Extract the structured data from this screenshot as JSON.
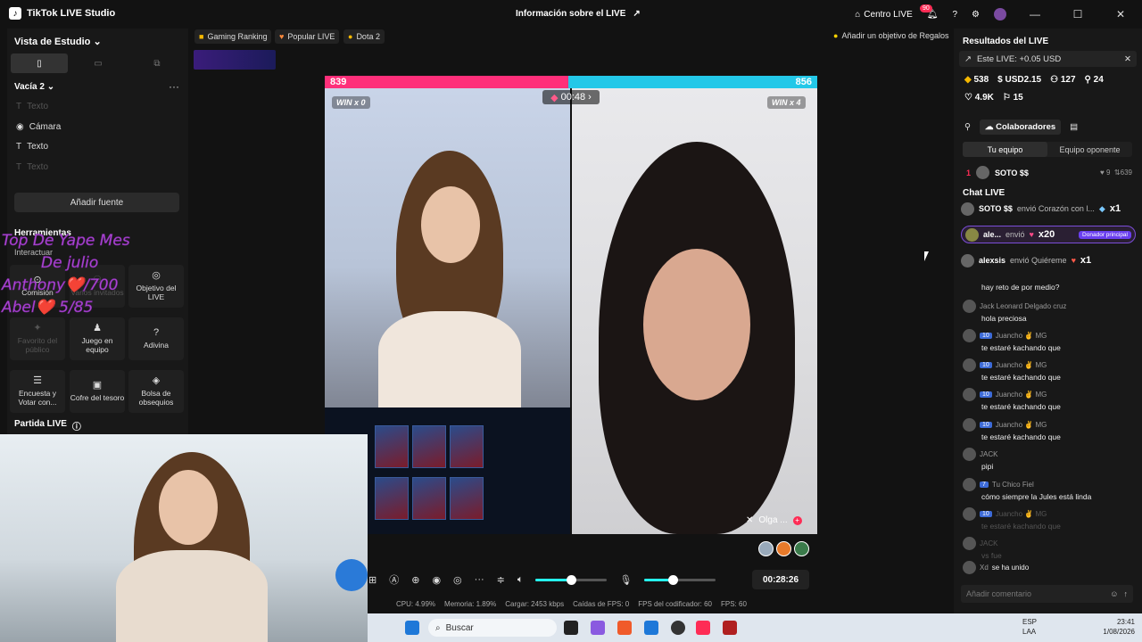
{
  "titlebar": {
    "app_name": "TikTok LIVE Studio",
    "center_title": "Información sobre el LIVE",
    "centro_live": "Centro LIVE",
    "notif_count": "90"
  },
  "left_panel": {
    "title": "Vista de Estudio",
    "scene_name": "Vacía 2",
    "sources": [
      "Texto",
      "Cámara",
      "Texto",
      "Texto"
    ],
    "add_source": "Añadir fuente",
    "tools_header": "Herramientas",
    "interact_label": "Interactuar",
    "tools": [
      {
        "label": "Comisión",
        "icon": "commission-icon"
      },
      {
        "label": "Varios invitados",
        "icon": "guests-icon"
      },
      {
        "label": "Objetivo del LIVE",
        "icon": "target-icon"
      },
      {
        "label": "Favorito del público",
        "icon": "star-icon"
      },
      {
        "label": "Juego en equipo",
        "icon": "team-icon"
      },
      {
        "label": "Adivina",
        "icon": "question-icon"
      },
      {
        "label": "Encuesta y Votar con...",
        "icon": "poll-icon"
      },
      {
        "label": "Cofre del tesoro",
        "icon": "chest-icon"
      },
      {
        "label": "Bolsa de obsequios",
        "icon": "bag-icon"
      }
    ],
    "partida": "Partida LIVE"
  },
  "overlay_text": {
    "line1": "Top De Yape  Mes",
    "line2": "De julio",
    "line3": "Anthony❤️/700",
    "line4": "Abel❤️      5/85"
  },
  "topbar": {
    "pills": [
      "Gaming Ranking",
      "Popular LIVE",
      "Dota 2"
    ],
    "goal": "Añadir un objetivo de Regalos"
  },
  "battle": {
    "left_score": "839",
    "right_score": "856",
    "left_win": "WIN x 0",
    "right_win": "WIN x 4",
    "timer": "00:48",
    "guest_name": "Olga ..."
  },
  "controls": {
    "elapsed": "00:28:26",
    "volume": 0.5,
    "mic": 0.4
  },
  "stats": {
    "cpu": "CPU: 4.99%",
    "mem": "Memoria: 1.89%",
    "load": "Cargar: 2453 kbps",
    "fps_drops": "Caídas de FPS: 0",
    "enc_fps": "FPS del codificador: 60",
    "fps": "FPS: 60"
  },
  "taskbar": {
    "search": "Buscar",
    "lang1": "ESP",
    "lang2": "LAA",
    "time": "23:41",
    "date": "1/08/2026"
  },
  "right_panel": {
    "title": "Resultados del LIVE",
    "este_live": "Este LIVE: +0.05 USD",
    "m1": "538",
    "m2": "USD2.15",
    "m3": "127",
    "m4": "24",
    "m5": "4.9K",
    "m6": "15",
    "collab": "Colaboradores",
    "tab_mine": "Tu equipo",
    "tab_opp": "Equipo oponente",
    "rank_num": "1",
    "rank_name": "SOTO $$",
    "rank_hearts": "9",
    "rank_points": "639",
    "chat_header": "Chat LIVE",
    "gifts": [
      {
        "user": "SOTO $$",
        "action": "envió Corazón con l...",
        "qty": "x1"
      },
      {
        "user": "ale...",
        "action": "envió",
        "qty": "x20",
        "badge": "Donador principal"
      },
      {
        "user": "alexsis",
        "action": "envió Quiéreme",
        "qty": "x1"
      }
    ],
    "messages": [
      {
        "user": "",
        "text": "hay reto de por medio?",
        "lvl": ""
      },
      {
        "user": "Jack Leonard Delgado cruz",
        "text": "hola preciosa",
        "lvl": ""
      },
      {
        "user": "Juancho ✌ MG",
        "text": "te estaré kachando que",
        "lvl": "10"
      },
      {
        "user": "Juancho ✌ MG",
        "text": "te estaré kachando que",
        "lvl": "10"
      },
      {
        "user": "Juancho ✌ MG",
        "text": "te estaré kachando que",
        "lvl": "10"
      },
      {
        "user": "Juancho ✌ MG",
        "text": "te estaré kachando que",
        "lvl": "10"
      },
      {
        "user": "JACK",
        "text": "pipi",
        "lvl": ""
      },
      {
        "user": "Tu Chico Fiel",
        "text": "cómo siempre la Jules está linda",
        "lvl": "7"
      },
      {
        "user": "Juancho ✌ MG",
        "text": "te estaré kachando que",
        "lvl": "10"
      },
      {
        "user": "JACK",
        "text": "vs fue",
        "lvl": ""
      }
    ],
    "joined_user": "Xd",
    "joined_text": "se ha unido",
    "comment_placeholder": "Añadir comentario"
  }
}
